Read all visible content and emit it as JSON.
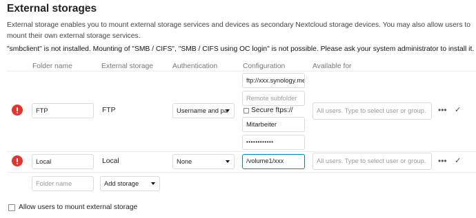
{
  "header": {
    "title": "External storages",
    "info_icon": "i",
    "description": "External storage enables you to mount external storage services and devices as secondary Nextcloud storage devices. You may also allow users to mount their own external storage services.",
    "warning": "\"smbclient\" is not installed. Mounting of \"SMB / CIFS\", \"SMB / CIFS using OC login\" is not possible. Please ask your system administrator to install it."
  },
  "table": {
    "columns": [
      "Folder name",
      "External storage",
      "Authentication",
      "Configuration",
      "Available for"
    ],
    "rows": [
      {
        "status_icon": "error-icon",
        "folder_name": "FTP",
        "backend": "FTP",
        "auth": "Username and pa",
        "config": {
          "host": "ftp://xxx.synology.me",
          "subfolder_placeholder": "Remote subfolder",
          "secure_label": "Secure ftps://",
          "secure_checked": false,
          "user": "Mitarbeiter",
          "password": "••••••••••••"
        },
        "available_placeholder": "All users. Type to select user or group.",
        "more": "•••",
        "save": "✓"
      },
      {
        "status_icon": "error-icon",
        "folder_name": "Local",
        "backend": "Local",
        "auth": "None",
        "config": {
          "path": "/volume1/xxx"
        },
        "available_placeholder": "All users. Type to select user or group.",
        "more": "•••",
        "save": "✓"
      }
    ],
    "new_row": {
      "folder_placeholder": "Folder name",
      "add_storage": "Add storage"
    }
  },
  "footer": {
    "allow_user_mount_label": "Allow users to mount external storage",
    "allow_user_mount_checked": false
  },
  "colors": {
    "error": "#e9322d",
    "focus_border": "#0082c9",
    "border": "#dbdbdb"
  }
}
